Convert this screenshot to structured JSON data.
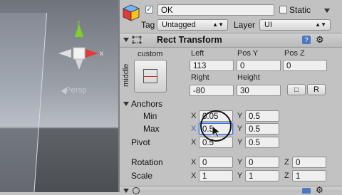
{
  "scene": {
    "view_label": "Persp"
  },
  "object": {
    "active": true,
    "name": "OK",
    "static_label": "Static",
    "static_checked": false,
    "tag_label": "Tag",
    "tag_value": "Untagged",
    "layer_label": "Layer",
    "layer_value": "UI"
  },
  "rect_transform": {
    "title": "Rect Transform",
    "anchor_preset_top": "custom",
    "anchor_preset_side": "middle",
    "col1": "Left",
    "col2": "Pos Y",
    "col3": "Pos Z",
    "left": "113",
    "pos_y": "0",
    "pos_z": "0",
    "col4": "Right",
    "col5": "Height",
    "right": "-80",
    "height": "30",
    "raw_btn": "R",
    "anchors": {
      "label": "Anchors",
      "min_label": "Min",
      "min_x": "0.05",
      "min_y": "0.5",
      "max_label": "Max",
      "max_x": "0.5",
      "max_y": "0.5"
    },
    "pivot": {
      "label": "Pivot",
      "x": "0.5",
      "y": "0.5"
    },
    "rotation": {
      "label": "Rotation",
      "x": "0",
      "y": "0",
      "z": "0"
    },
    "scale": {
      "label": "Scale",
      "x": "1",
      "y": "1",
      "z": "1"
    },
    "axis_x": "X",
    "axis_y": "Y",
    "axis_z": "Z"
  },
  "colors": {
    "gizmo_y": "#7ed321",
    "gizmo_x": "#e53935",
    "help_icon": "#4a78c2"
  }
}
